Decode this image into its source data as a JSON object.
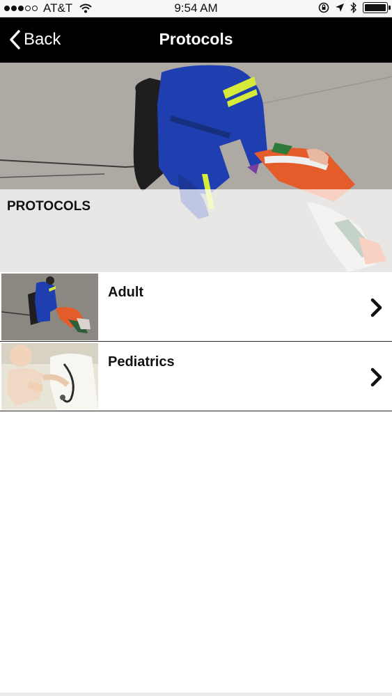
{
  "status_bar": {
    "carrier": "AT&T",
    "time": "9:54 AM",
    "signal_bars_filled": 3,
    "signal_bars_total": 5,
    "battery_level": 1.0
  },
  "nav": {
    "back_label": "Back",
    "title": "Protocols"
  },
  "hero": {
    "heading": "PROTOCOLS"
  },
  "list": {
    "items": [
      {
        "label": "Adult"
      },
      {
        "label": "Pediatrics"
      }
    ]
  },
  "colors": {
    "nav_background": "#000000",
    "uniform_blue": "#1f3fb0",
    "reflective_stripe": "#d6ea3a"
  }
}
